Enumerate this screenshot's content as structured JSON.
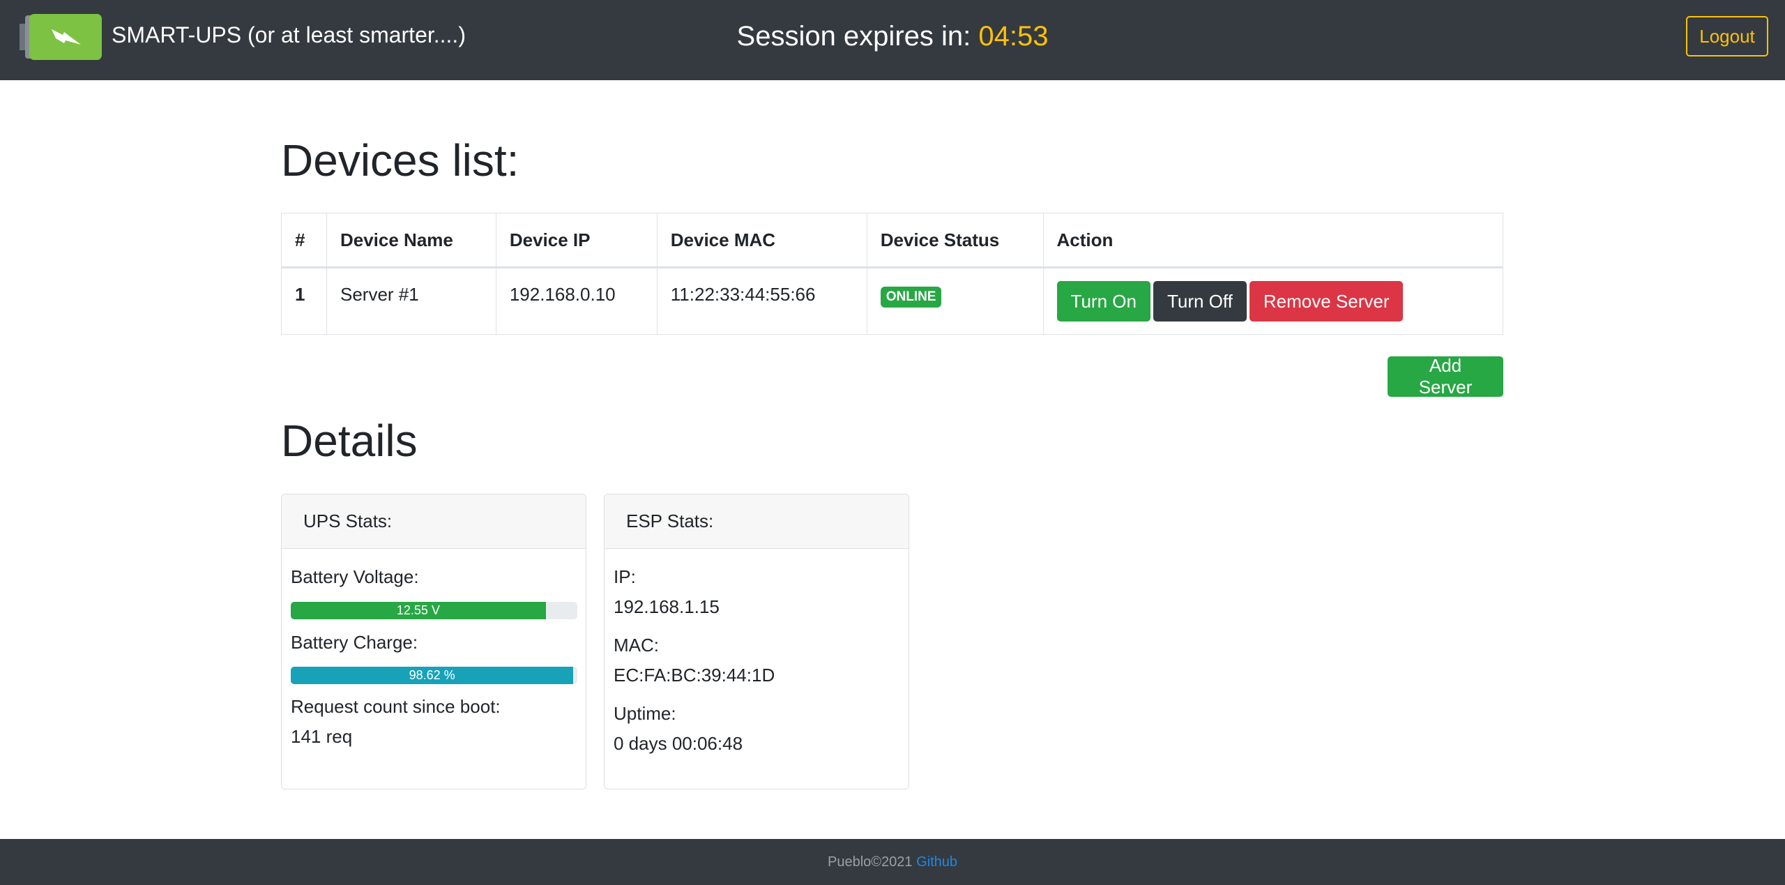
{
  "header": {
    "brand": "SMART-UPS (or at least smarter....)",
    "session_label": "Session expires in:",
    "session_timer": "04:53",
    "logout_label": "Logout"
  },
  "devices": {
    "title": "Devices list:",
    "columns": [
      "#",
      "Device Name",
      "Device IP",
      "Device MAC",
      "Device Status",
      "Action"
    ],
    "rows": [
      {
        "num": "1",
        "name": "Server #1",
        "ip": "192.168.0.10",
        "mac": "11:22:33:44:55:66",
        "status": "ONLINE",
        "actions": {
          "turn_on": "Turn On",
          "turn_off": "Turn Off",
          "remove": "Remove Server"
        }
      }
    ],
    "add_label": "Add Server"
  },
  "details": {
    "title": "Details",
    "ups": {
      "header": "UPS Stats:",
      "voltage_label": "Battery Voltage:",
      "voltage_text": "12.55 V",
      "voltage_percent": 89,
      "charge_label": "Battery Charge:",
      "charge_text": "98.62 %",
      "charge_percent": 98.62,
      "requests_label": "Request count since boot:",
      "requests_value": "141 req"
    },
    "esp": {
      "header": "ESP Stats:",
      "ip_label": "IP:",
      "ip_value": "192.168.1.15",
      "mac_label": "MAC:",
      "mac_value": "EC:FA:BC:39:44:1D",
      "uptime_label": "Uptime:",
      "uptime_value": "0 days 00:06:48"
    }
  },
  "footer": {
    "text": "Pueblo©2021",
    "link": "Github"
  },
  "colors": {
    "navbar": "#343a40",
    "timer": "#ffc107",
    "success": "#28a745",
    "danger": "#dc3545",
    "info": "#17a2b8",
    "logo_green": "#7dc242"
  },
  "icons": {
    "logo": "battery-lightning-icon"
  }
}
